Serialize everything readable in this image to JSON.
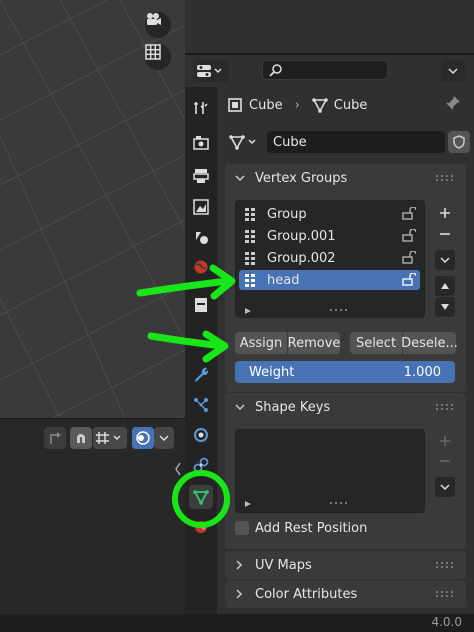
{
  "header": {
    "object_name": "Cube",
    "mesh_name": "Cube",
    "data_block_value": "Cube",
    "search_placeholder": ""
  },
  "vertex_groups": {
    "title": "Vertex Groups",
    "items": [
      {
        "label": "Group",
        "selected": false
      },
      {
        "label": "Group.001",
        "selected": false
      },
      {
        "label": "Group.002",
        "selected": false
      },
      {
        "label": "head",
        "selected": true
      }
    ],
    "buttons": {
      "assign": "Assign",
      "remove": "Remove",
      "select": "Select",
      "deselect": "Desele..."
    },
    "weight_label": "Weight",
    "weight_value": "1.000"
  },
  "shape_keys": {
    "title": "Shape Keys",
    "add_rest_position": "Add Rest Position",
    "add_rest_checked": false
  },
  "collapsed_sections": {
    "uv_maps": "UV Maps",
    "color_attributes": "Color Attributes"
  },
  "status_bar": {
    "version": "4.0.0"
  },
  "colors": {
    "selection_blue": "#4772b3",
    "annotation_green": "#19e619",
    "panel_bg": "#303030",
    "section_bg": "#3a3a3a"
  },
  "icons": [
    "camera-icon",
    "grid-icon",
    "editor-type-icon",
    "search-icon",
    "object-icon",
    "mesh-data-icon",
    "pin-icon",
    "shield-icon",
    "tool-icon",
    "render-icon",
    "output-icon",
    "view-layer-icon",
    "scene-icon",
    "world-icon",
    "collection-icon",
    "modifier-icon",
    "particles-icon",
    "physics-icon",
    "constraints-icon",
    "data-icon",
    "material-icon",
    "vertex-group-icon",
    "lock-icon",
    "plus-icon",
    "minus-icon",
    "chevron-down-icon",
    "arrow-up-icon",
    "arrow-down-icon"
  ]
}
